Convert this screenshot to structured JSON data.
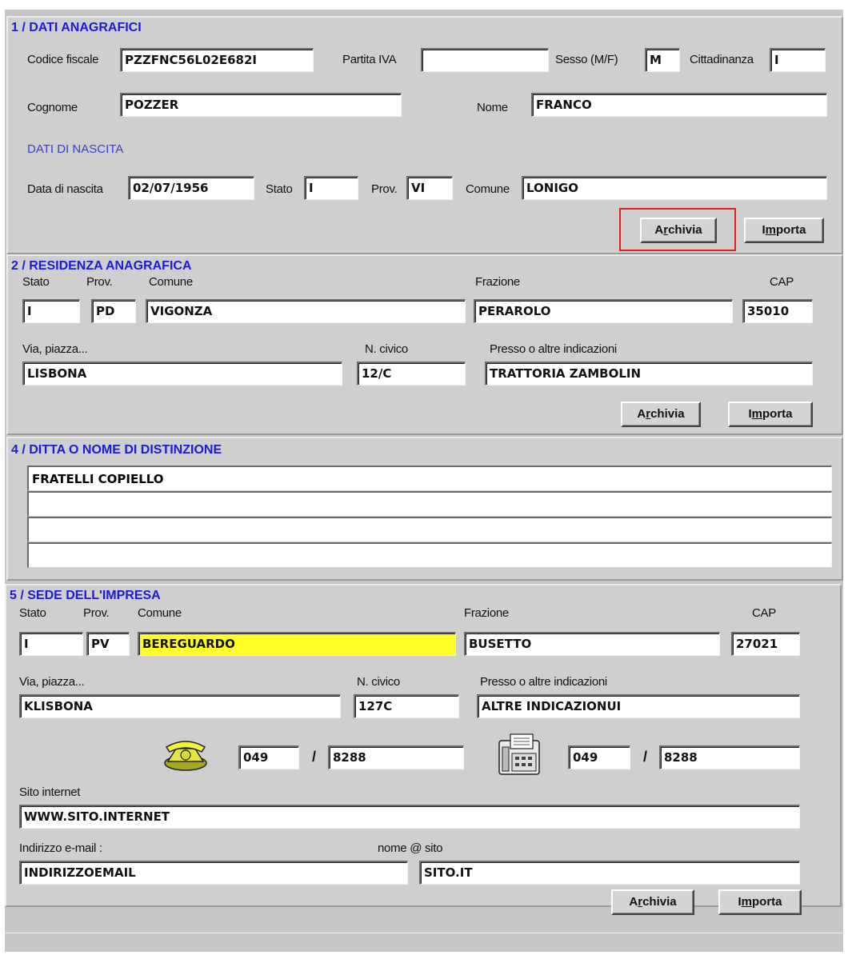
{
  "sec1": {
    "title": "1 / DATI ANAGRAFICI",
    "codice_fiscale_label": "Codice fiscale",
    "codice_fiscale": "PZZFNC56L02E682I",
    "partita_iva_label": "Partita IVA",
    "partita_iva": "",
    "sesso_label": "Sesso (M/F)",
    "sesso": "M",
    "cittadinanza_label": "Cittadinanza",
    "cittadinanza": "I",
    "cognome_label": "Cognome",
    "cognome": "POZZER",
    "nome_label": "Nome",
    "nome": "FRANCO",
    "nascita_title": "DATI DI NASCITA",
    "data_label": "Data di nascita",
    "data": "02/07/1956",
    "stato_label": "Stato",
    "stato": "I",
    "prov_label": "Prov.",
    "prov": "VI",
    "comune_label": "Comune",
    "comune": "LONIGO",
    "archivia_a": "A",
    "archivia_u": "r",
    "archivia_b": "chivia",
    "importa_a": "I",
    "importa_u": "m",
    "importa_b": "porta"
  },
  "sec2": {
    "title": "2 / RESIDENZA ANAGRAFICA",
    "stato_label": "Stato",
    "stato": "I",
    "prov_label": "Prov.",
    "prov": "PD",
    "comune_label": "Comune",
    "comune": "VIGONZA",
    "frazione_label": "Frazione",
    "frazione": "PERAROLO",
    "cap_label": "CAP",
    "cap": "35010",
    "via_label": "Via, piazza...",
    "via": "LISBONA",
    "civico_label": "N. civico",
    "civico": "12/C",
    "presso_label": "Presso o altre indicazioni",
    "presso": "TRATTORIA ZAMBOLIN"
  },
  "sec4": {
    "title": "4 / DITTA O NOME DI DISTINZIONE",
    "rows": [
      "FRATELLI COPIELLO",
      "",
      "",
      ""
    ]
  },
  "sec5": {
    "title": "5 / SEDE DELL'IMPRESA",
    "stato_label": "Stato",
    "stato": "I",
    "prov_label": "Prov.",
    "prov": "PV",
    "comune_label": "Comune",
    "comune": "BEREGUARDO",
    "frazione_label": "Frazione",
    "frazione": "BUSETTO",
    "cap_label": "CAP",
    "cap": "27021",
    "via_label": "Via, piazza...",
    "via": "KLISBONA",
    "civico_label": "N. civico",
    "civico": "127C",
    "presso_label": "Presso o altre indicazioni",
    "presso": "ALTRE INDICAZIONUI",
    "tel_prefix": "049",
    "tel_number": "8288",
    "fax_prefix": "049",
    "fax_number": "8288",
    "slash": "/",
    "sito_label": "Sito internet",
    "sito": "WWW.SITO.INTERNET",
    "email_label": "Indirizzo e-mail :",
    "email_hint": "nome @ sito",
    "email_user": "INDIRIZZOEMAIL",
    "email_domain": "SITO.IT"
  },
  "colors": {
    "title": "#1a1ad8",
    "highlight_box": "#e21d1d",
    "comune_highlight": "#ffff2a"
  },
  "icons": [
    "telephone-icon",
    "fax-icon"
  ]
}
